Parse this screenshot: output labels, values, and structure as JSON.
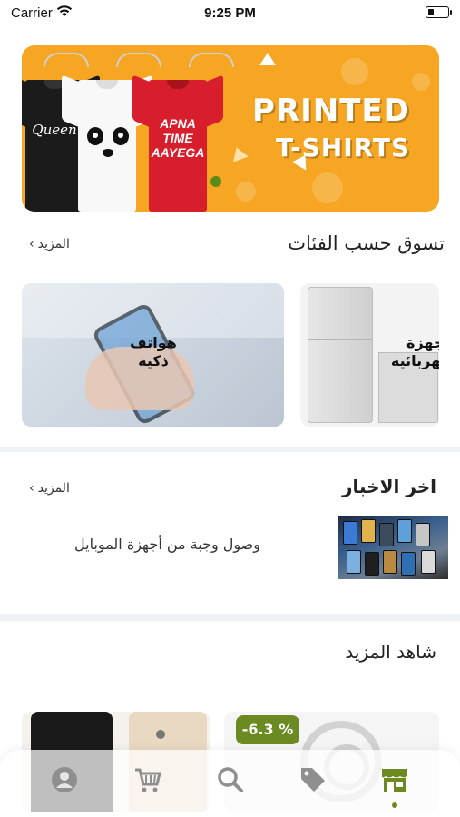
{
  "status_bar": {
    "carrier": "Carrier",
    "time": "9:25 PM"
  },
  "banner": {
    "shirt_1_print": "Queen",
    "shirt_3_print_line1": "APNA",
    "shirt_3_print_line2": "TIME",
    "shirt_3_print_line3": "AAYEGA",
    "headline_line1": "PRINTED",
    "headline_line2": "T-SHIRTS"
  },
  "categories_section": {
    "title": "تسوق حسب الفئات",
    "more_label": "المزيد",
    "items": [
      {
        "label_line1": "هواتف",
        "label_line2": "ذكية"
      },
      {
        "label_line1": "أجهزة",
        "label_line2": "كهربائية"
      }
    ]
  },
  "news_section": {
    "title": "اخر الاخبار",
    "more_label": "المزيد",
    "headline": "وصول وجبة من أجهزة الموبايل"
  },
  "see_more_section": {
    "title": "شاهد المزيد",
    "discount_badge": "-6.3 %"
  },
  "tab_bar": {
    "active_tab": "store",
    "accent_color": "#6c8a22",
    "icons": [
      "profile-icon",
      "cart-icon",
      "search-icon",
      "tag-icon",
      "store-icon"
    ]
  },
  "colors": {
    "banner_bg": "#f6a623",
    "accent": "#6c8a22",
    "page_bg": "#eef1f6"
  }
}
